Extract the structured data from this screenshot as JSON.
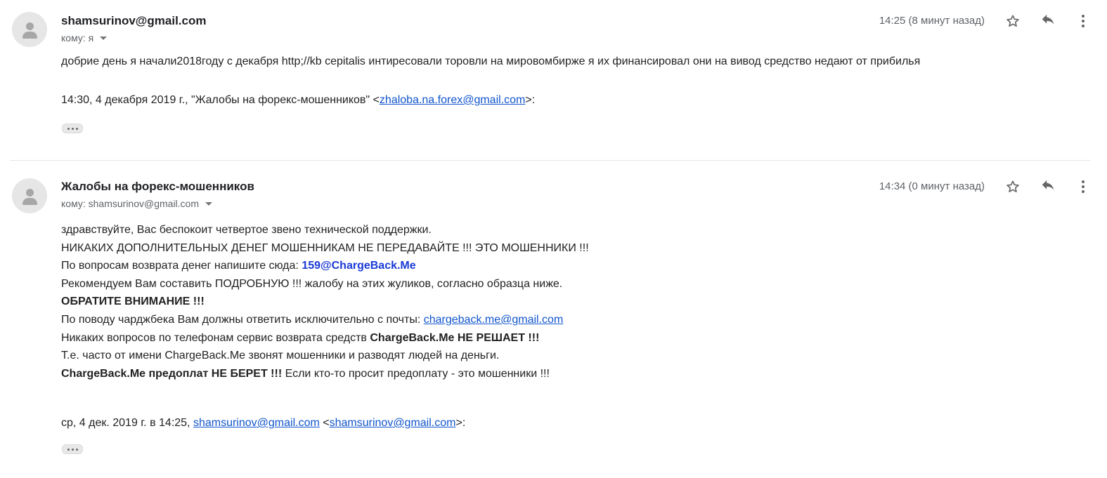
{
  "messages": [
    {
      "sender": "shamsurinov@gmail.com",
      "to": "кому: я",
      "time": "14:25 (8 минут назад)",
      "body_line": "добрие день я начали2018году с декабря http;//kb cepitalis интиресовали торовли на мировомбирже я их финансировал они на вивод средство недают от прибилья",
      "quote": {
        "prefix": "14:30, 4 декабря 2019 г., \"Жалобы на форекс-мошенников\" <",
        "email": "zhaloba.na.forex@gmail.com",
        "suffix": ">:"
      }
    },
    {
      "sender": "Жалобы на форекс-мошенников",
      "to": "кому: shamsurinov@gmail.com",
      "time": "14:34 (0 минут назад)",
      "lines": {
        "l1": "здравствуйте, Вас беспокоит четвертое звено технической поддержки.",
        "l2": "НИКАКИХ ДОПОЛНИТЕЛЬНЫХ ДЕНЕГ МОШЕННИКАМ НЕ ПЕРЕДАВАЙТЕ !!! ЭТО МОШЕННИКИ !!!",
        "l3_text": "По вопросам возврата денег напишите сюда: ",
        "l3_email": "159@ChargeBack.Me",
        "l4": "Рекомендуем Вам составить ПОДРОБНУЮ !!! жалобу на этих жуликов, согласно образца ниже.",
        "l5": "ОБРАТИТЕ ВНИМАНИЕ !!!",
        "l6_text": "По поводу чарджбека Вам должны ответить исключительно с почты: ",
        "l6_email": "chargeback.me@gmail.com",
        "l7_text": "Никаких вопросов по телефонам сервис возврата средств ",
        "l7_bold": "ChargeBack.Me НЕ РЕШАЕТ !!!",
        "l8": "Т.е. часто от имени ChargeBack.Me звонят мошенники и разводят людей на деньги.",
        "l9_bold": "ChargeBack.Me предоплат НЕ БЕРЕТ !!!",
        "l9_text": " Если кто-то просит предоплату - это мошенники !!!"
      },
      "quote": {
        "prefix": "ср, 4 дек. 2019 г. в 14:25, ",
        "email1": "shamsurinov@gmail.com",
        "mid": " <",
        "email2": "shamsurinov@gmail.com",
        "suffix": ">:"
      }
    }
  ],
  "icons": [
    "avatar-icon",
    "star-icon",
    "reply-icon",
    "more-vert-icon",
    "show-trimmed-icon",
    "chevron-down-icon"
  ],
  "colors": {
    "link": "#1155cc",
    "email_highlight": "#1a3ad6",
    "secondary_text": "#5f6368"
  }
}
